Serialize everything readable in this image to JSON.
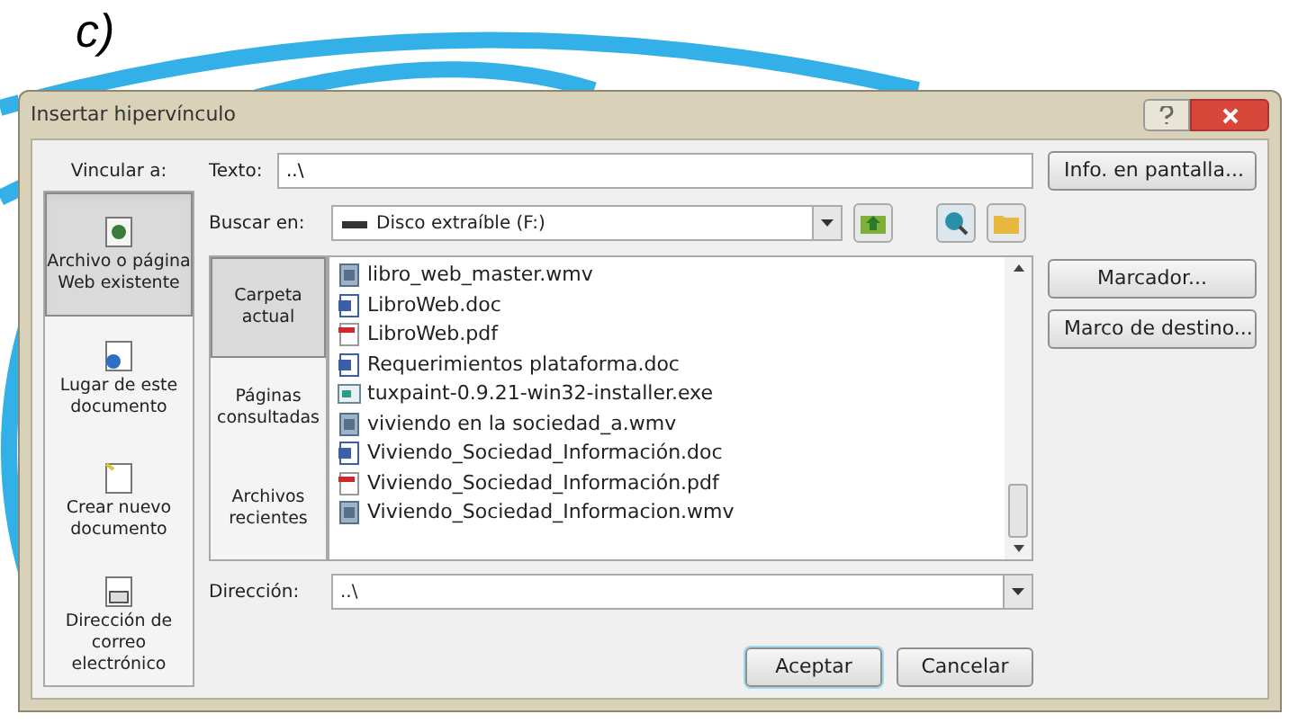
{
  "label": "c)",
  "window": {
    "title": "Insertar hipervínculo"
  },
  "link_to": {
    "heading": "Vincular a:",
    "items": [
      {
        "label": "Archivo o página Web existente",
        "selected": true,
        "kind": "file"
      },
      {
        "label": "Lugar de este documento",
        "selected": false,
        "kind": "place"
      },
      {
        "label": "Crear nuevo documento",
        "selected": false,
        "kind": "new"
      },
      {
        "label": "Dirección de correo electrónico",
        "selected": false,
        "kind": "mail"
      }
    ]
  },
  "text_field": {
    "label": "Texto:",
    "value": "..\\"
  },
  "screen_tip_button": "Info. en pantalla...",
  "look_in": {
    "label": "Buscar en:",
    "value": "Disco extraíble (F:)"
  },
  "places": [
    {
      "label": "Carpeta actual",
      "selected": true
    },
    {
      "label": "Páginas consultadas",
      "selected": false
    },
    {
      "label": "Archivos recientes",
      "selected": false
    }
  ],
  "files": [
    {
      "name": "libro_web_master.wmv",
      "kind": "video"
    },
    {
      "name": "LibroWeb.doc",
      "kind": "doc"
    },
    {
      "name": "LibroWeb.pdf",
      "kind": "pdf"
    },
    {
      "name": "Requerimientos plataforma.doc",
      "kind": "doc"
    },
    {
      "name": "tuxpaint-0.9.21-win32-installer.exe",
      "kind": "exe"
    },
    {
      "name": "viviendo en la sociedad_a.wmv",
      "kind": "video"
    },
    {
      "name": "Viviendo_Sociedad_Información.doc",
      "kind": "doc"
    },
    {
      "name": "Viviendo_Sociedad_Información.pdf",
      "kind": "pdf"
    },
    {
      "name": "Viviendo_Sociedad_Informacion.wmv",
      "kind": "video"
    }
  ],
  "side_buttons": [
    "Marcador...",
    "Marco de destino..."
  ],
  "address": {
    "label": "Dirección:",
    "value": "..\\"
  },
  "buttons": [
    {
      "label": "Aceptar",
      "default": true
    },
    {
      "label": "Cancelar",
      "default": false
    }
  ]
}
